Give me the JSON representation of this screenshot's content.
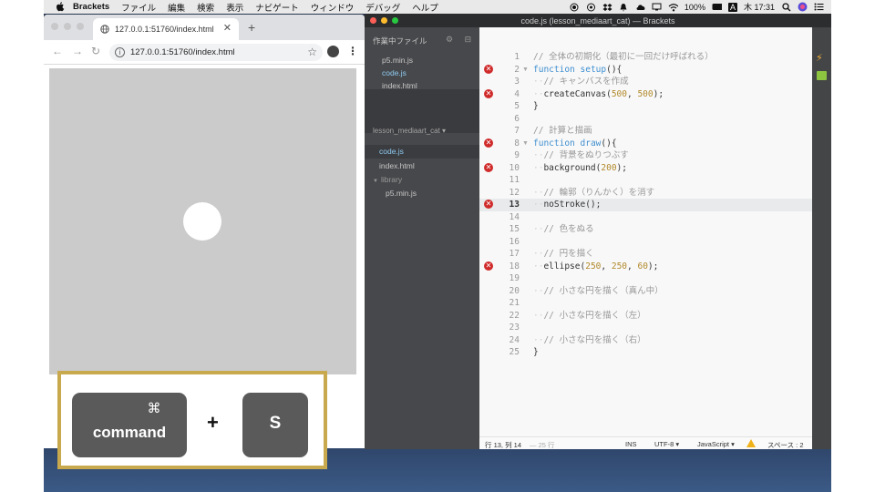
{
  "menubar": {
    "app_name": "Brackets",
    "items": [
      "ファイル",
      "編集",
      "検索",
      "表示",
      "ナビゲート",
      "ウィンドウ",
      "デバッグ",
      "ヘルプ"
    ],
    "battery": "100%",
    "input_method": "A",
    "clock": "木 17:31"
  },
  "browser": {
    "tab_title": "127.0.0.1:51760/index.html",
    "url": "127.0.0.1:51760/index.html"
  },
  "shortcut": {
    "command_symbol": "⌘",
    "command_label": "command",
    "plus": "+",
    "s_label": "S"
  },
  "brackets": {
    "window_title": "code.js (lesson_mediaart_cat) — Brackets",
    "working_files_header": "作業中ファイル",
    "working_files": [
      "p5.min.js",
      "code.js",
      "index.html"
    ],
    "project_name": "lesson_mediaart_cat ▾",
    "project_tree": [
      "code.js",
      "index.html",
      "library",
      "p5.min.js"
    ],
    "status": {
      "position": "行 13, 列 14",
      "line_count": "— 25 行",
      "mode": "INS",
      "encoding": "UTF-8 ▾",
      "language": "JavaScript ▾",
      "spaces": "スペース : 2"
    },
    "code": [
      {
        "n": "1",
        "text": "// 全体の初期化（最初に一回だけ呼ばれる）",
        "err": false
      },
      {
        "n": "2",
        "text": "function setup(){",
        "err": true,
        "fold": true
      },
      {
        "n": "3",
        "text": "  // キャンバスを作成",
        "err": false
      },
      {
        "n": "4",
        "text": "  createCanvas(500, 500);",
        "err": true
      },
      {
        "n": "5",
        "text": "}",
        "err": false
      },
      {
        "n": "6",
        "text": "",
        "err": false
      },
      {
        "n": "7",
        "text": "// 計算と描画",
        "err": false
      },
      {
        "n": "8",
        "text": "function draw(){",
        "err": true,
        "fold": true
      },
      {
        "n": "9",
        "text": "  // 背景をぬりつぶす",
        "err": false
      },
      {
        "n": "10",
        "text": "  background(200);",
        "err": true
      },
      {
        "n": "11",
        "text": "",
        "err": false
      },
      {
        "n": "12",
        "text": "  // 輪郭（りんかく）を消す",
        "err": false
      },
      {
        "n": "13",
        "text": "  noStroke();",
        "err": true,
        "active": true
      },
      {
        "n": "14",
        "text": "",
        "err": false
      },
      {
        "n": "15",
        "text": "  // 色をぬる",
        "err": false
      },
      {
        "n": "16",
        "text": "",
        "err": false
      },
      {
        "n": "17",
        "text": "  // 円を描く",
        "err": false
      },
      {
        "n": "18",
        "text": "  ellipse(250, 250, 60);",
        "err": true
      },
      {
        "n": "19",
        "text": "",
        "err": false
      },
      {
        "n": "20",
        "text": "  // 小さな円を描く（真ん中）",
        "err": false
      },
      {
        "n": "21",
        "text": "",
        "err": false
      },
      {
        "n": "22",
        "text": "  // 小さな円を描く（左）",
        "err": false
      },
      {
        "n": "23",
        "text": "",
        "err": false
      },
      {
        "n": "24",
        "text": "  // 小さな円を描く（右）",
        "err": false
      },
      {
        "n": "25",
        "text": "}",
        "err": false
      }
    ]
  }
}
